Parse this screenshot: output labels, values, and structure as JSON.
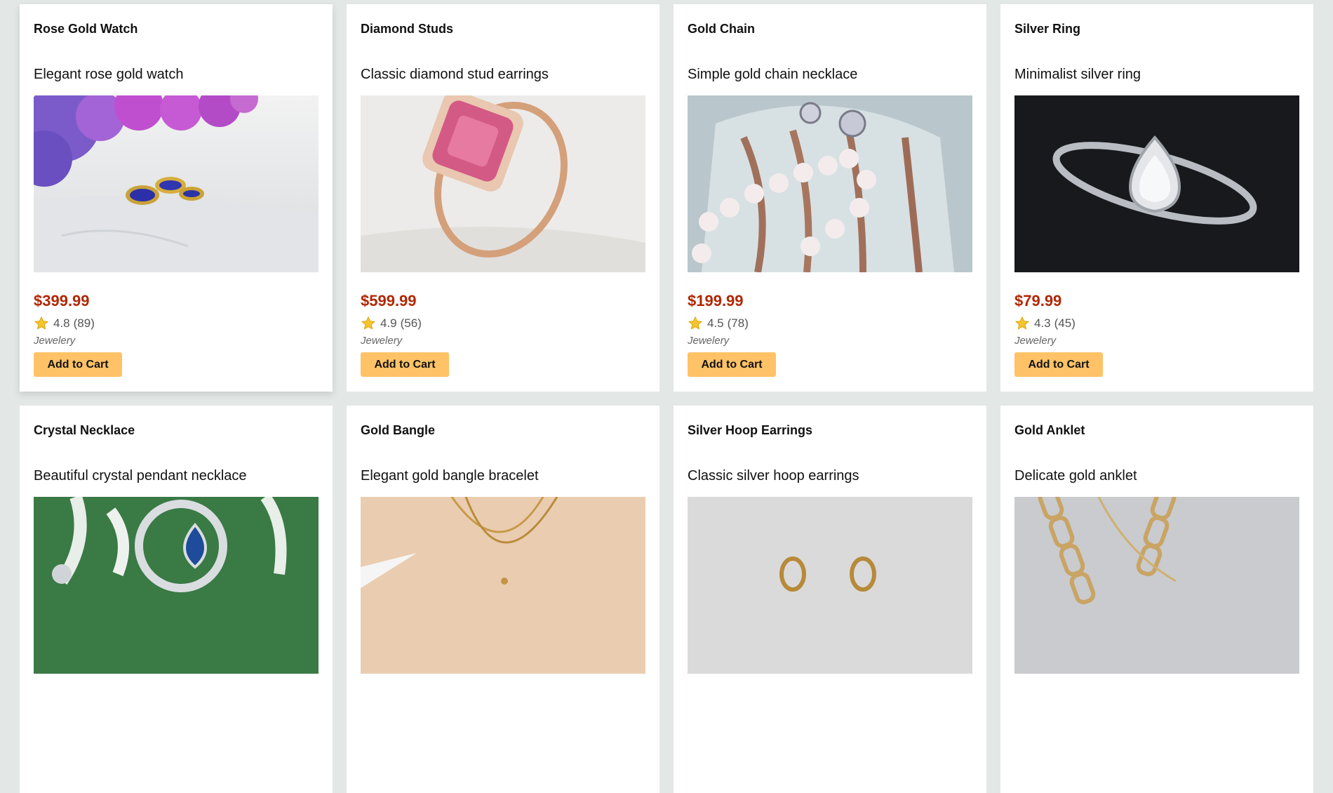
{
  "products": [
    {
      "title": "Rose Gold Watch",
      "description": "Elegant rose gold watch",
      "price": "$399.99",
      "rating": "4.8",
      "reviews": "(89)",
      "category": "Jewelery",
      "button": "Add to Cart",
      "image_icon": "gold-rings-on-marble-image"
    },
    {
      "title": "Diamond Studs",
      "description": "Classic diamond stud earrings",
      "price": "$599.99",
      "rating": "4.9",
      "reviews": "(56)",
      "category": "Jewelery",
      "button": "Add to Cart",
      "image_icon": "pink-gem-ring-image"
    },
    {
      "title": "Gold Chain",
      "description": "Simple gold chain necklace",
      "price": "$199.99",
      "rating": "4.5",
      "reviews": "(78)",
      "category": "Jewelery",
      "button": "Add to Cart",
      "image_icon": "pearls-on-shell-image"
    },
    {
      "title": "Silver Ring",
      "description": "Minimalist silver ring",
      "price": "$79.99",
      "rating": "4.3",
      "reviews": "(45)",
      "category": "Jewelery",
      "button": "Add to Cart",
      "image_icon": "diamond-ring-dark-image"
    },
    {
      "title": "Crystal Necklace",
      "description": "Beautiful crystal pendant necklace",
      "image_icon": "crystal-necklace-on-leaf-image"
    },
    {
      "title": "Gold Bangle",
      "description": "Elegant gold bangle bracelet",
      "image_icon": "gold-necklace-on-neck-image"
    },
    {
      "title": "Silver Hoop Earrings",
      "description": "Classic silver hoop earrings",
      "image_icon": "gold-earrings-grey-image"
    },
    {
      "title": "Gold Anklet",
      "description": "Delicate gold anklet",
      "image_icon": "gold-link-chain-image"
    }
  ],
  "colors": {
    "price": "#b12704",
    "button": "#ffc266",
    "background": "#e3e7e6"
  }
}
